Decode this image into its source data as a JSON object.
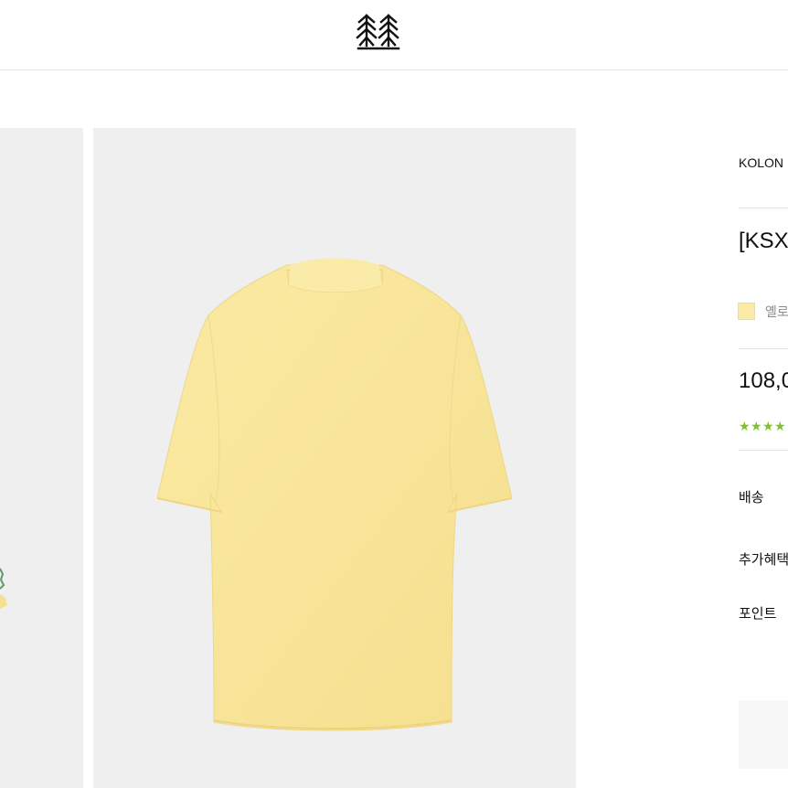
{
  "header": {
    "logo_icon": "brand-tree-logo-icon"
  },
  "gallery": {
    "main_image": "yellow polo shirt back view",
    "shirt_color": "#f9e69b"
  },
  "product": {
    "brand": "KOLON",
    "title": "[KSX",
    "color_swatch": "#fbeaa6",
    "color_name": "옐로",
    "price": "108,0",
    "rating_stars": 4,
    "star_color": "#7cc32a"
  },
  "details": {
    "shipping_label": "배송",
    "extra_benefit_label": "추가혜택",
    "points_label": "포인트"
  }
}
